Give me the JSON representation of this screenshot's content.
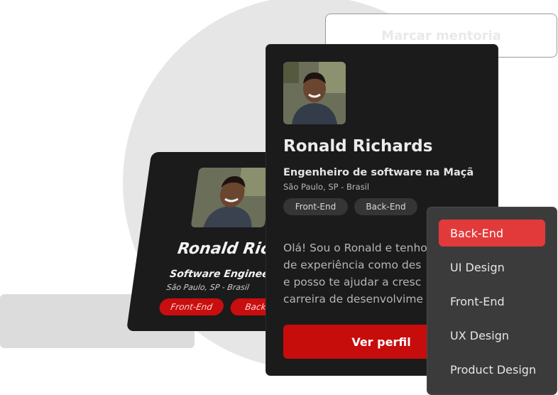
{
  "background_button": {
    "label": "Marcar mentoria"
  },
  "skewed_card": {
    "name": "Ronald Rich",
    "role": "Software Engineer",
    "location": "São Paulo, SP - Brasil",
    "tags": [
      "Front-End",
      "Back-En"
    ]
  },
  "main_card": {
    "name": "Ronald Richards",
    "role": "Engenheiro de software na Maçã",
    "location": "São Paulo, SP - Brasil",
    "tags": [
      "Front-End",
      "Back-End"
    ],
    "bio_lines": [
      "Olá! Sou o Ronald e tenho",
      "de experiência como des",
      "e posso te ajudar a cresc",
      "carreira de desenvolvime"
    ],
    "cta_label": "Ver perfil"
  },
  "dropdown": {
    "selected": "Back-End",
    "items": [
      "Back-End",
      "UI Design",
      "Front-End",
      "UX Design",
      "Product Design"
    ]
  },
  "colors": {
    "accent": "#c70c0c",
    "menu_active": "#e23a3a",
    "card_bg": "#1b1b1b"
  },
  "icons": {
    "avatar": "person-avatar"
  }
}
